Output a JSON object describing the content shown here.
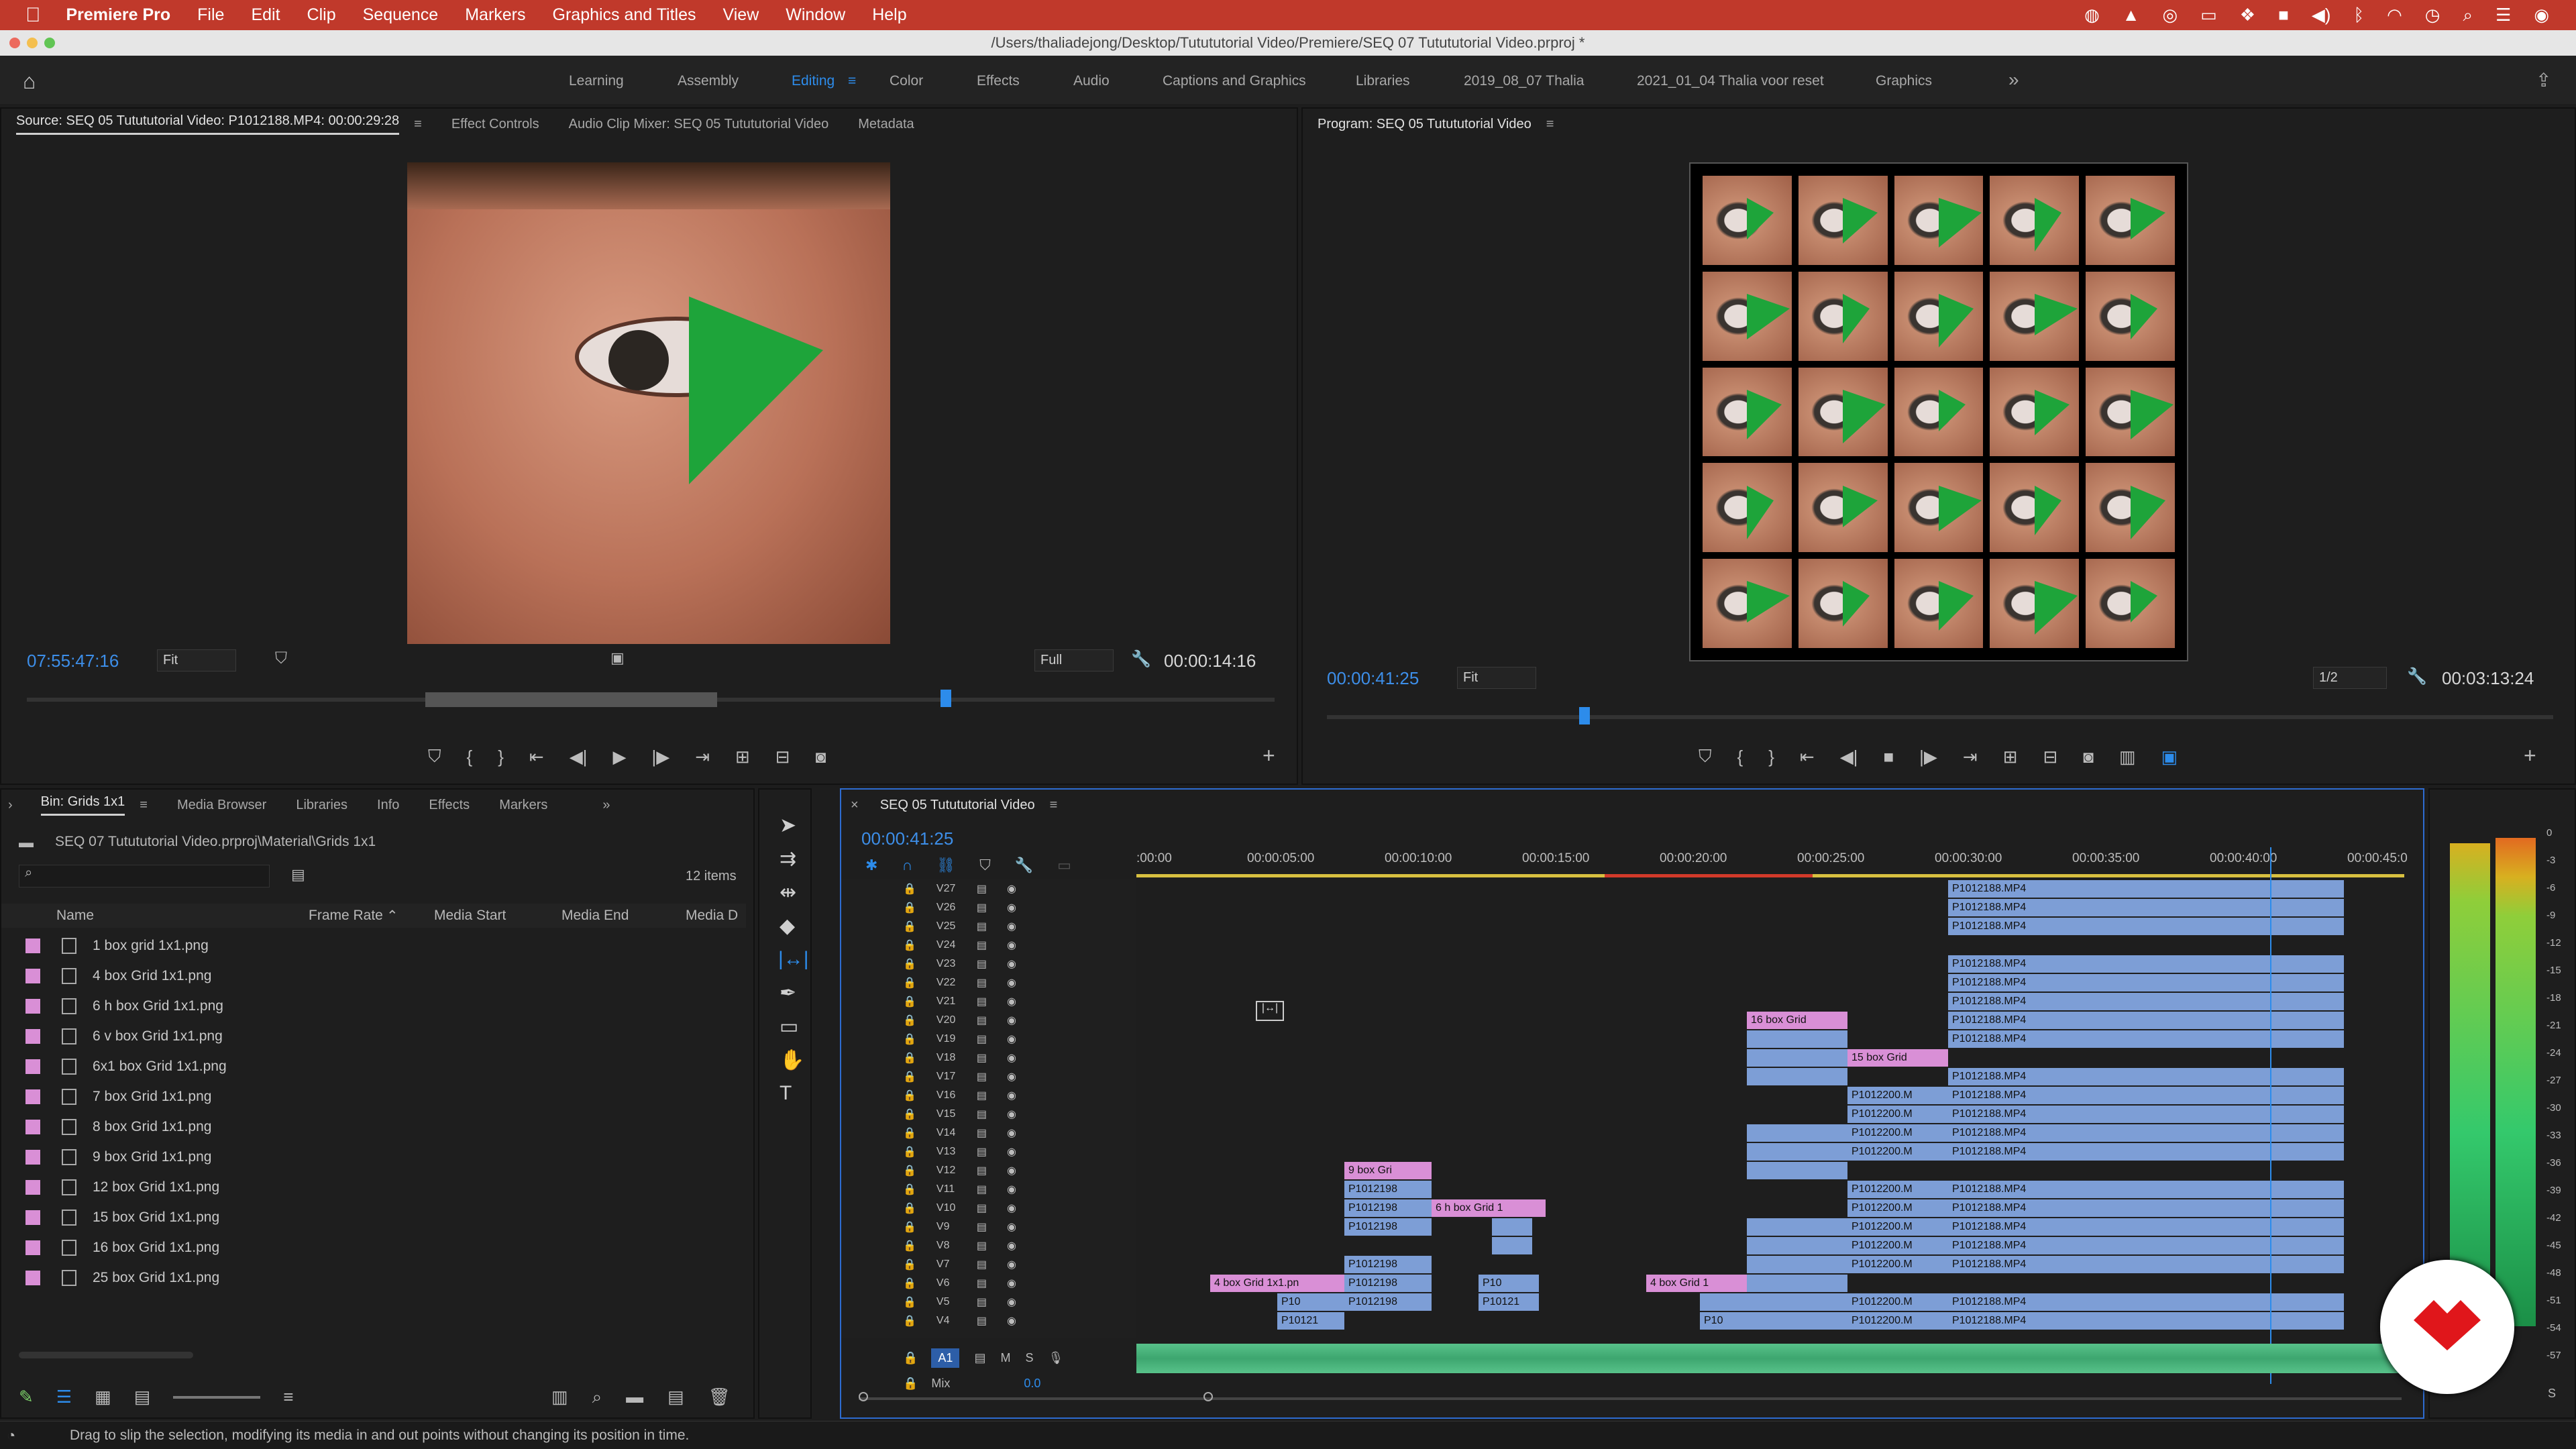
{
  "menubar": {
    "app": "Premiere Pro",
    "items": [
      "File",
      "Edit",
      "Clip",
      "Sequence",
      "Markers",
      "Graphics and Titles",
      "View",
      "Window",
      "Help"
    ]
  },
  "titlebar": {
    "path": "/Users/thaliadejong/Desktop/Tutututorial Video/Premiere/SEQ 07 Tutututorial Video.prproj *"
  },
  "workspaces": {
    "tabs": [
      "Learning",
      "Assembly",
      "Editing",
      "Color",
      "Effects",
      "Audio",
      "Captions and Graphics",
      "Libraries",
      "2019_08_07 Thalia",
      "2021_01_04 Thalia voor reset",
      "Graphics"
    ],
    "active": "Editing",
    "more": "»"
  },
  "source": {
    "tabs": [
      "Source: SEQ 05 Tutututorial Video: P1012188.MP4: 00:00:29:28",
      "Effect Controls",
      "Audio Clip Mixer: SEQ 05 Tutututorial Video",
      "Metadata"
    ],
    "timecode": "07:55:47:16",
    "fit": "Fit",
    "quality": "Full",
    "duration": "00:00:14:16"
  },
  "program": {
    "title": "Program: SEQ 05 Tutututorial Video",
    "timecode": "00:00:41:25",
    "fit": "Fit",
    "quality": "1/2",
    "duration": "00:03:13:24"
  },
  "project": {
    "tabs": [
      "Bin: Grids 1x1",
      "Media Browser",
      "Libraries",
      "Info",
      "Effects",
      "Markers"
    ],
    "path": "SEQ 07 Tutututorial Video.prproj\\Material\\Grids 1x1",
    "count": "12 items",
    "columns": [
      "Name",
      "Frame Rate",
      "Media Start",
      "Media End",
      "Media D"
    ],
    "files": [
      "1 box grid 1x1.png",
      "4 box Grid 1x1.png",
      "6 h box Grid 1x1.png",
      "6 v box Grid 1x1.png",
      "6x1 box Grid 1x1.png",
      "7 box Grid 1x1.png",
      "8 box Grid 1x1.png",
      "9 box Grid 1x1.png",
      "12 box Grid 1x1.png",
      "15 box Grid 1x1.png",
      "16 box Grid 1x1.png",
      "25 box Grid 1x1.png"
    ]
  },
  "timeline": {
    "title": "SEQ 05 Tutututorial Video",
    "timecode": "00:00:41:25",
    "ruler": [
      ":00:00",
      "00:00:05:00",
      "00:00:10:00",
      "00:00:15:00",
      "00:00:20:00",
      "00:00:25:00",
      "00:00:30:00",
      "00:00:35:00",
      "00:00:40:00",
      "00:00:45:0"
    ],
    "tracks": [
      "V27",
      "V26",
      "V25",
      "V24",
      "V23",
      "V22",
      "V21",
      "V20",
      "V19",
      "V18",
      "V17",
      "V16",
      "V15",
      "V14",
      "V13",
      "V12",
      "V11",
      "V10",
      "V9",
      "V8",
      "V7",
      "V6",
      "V5",
      "V4"
    ],
    "audio": {
      "name": "A1",
      "m": "M",
      "s": "S",
      "mix": "Mix",
      "mixval": "0.0"
    },
    "clips": {
      "p2188": "P1012188.MP4",
      "p2200": "P1012200.M",
      "p2198": "P1012198",
      "b16": "16 box Grid",
      "b15": "15 box Grid",
      "b9": "9 box Gri",
      "b6h": "6 h box Grid 1",
      "b4a": "4 box Grid 1x1.pn",
      "b4b": "4 box Grid 1",
      "p10": "P10",
      "p0121": "P10121"
    }
  },
  "meter": {
    "scale": [
      "0",
      "-3",
      "-6",
      "-9",
      "-12",
      "-15",
      "-18",
      "-21",
      "-24",
      "-27",
      "-30",
      "-33",
      "-36",
      "-39",
      "-42",
      "-45",
      "-48",
      "-51",
      "-54",
      "-57"
    ],
    "s": "S"
  },
  "status": "Drag to slip the selection, modifying its media in and out points without changing its position in time."
}
